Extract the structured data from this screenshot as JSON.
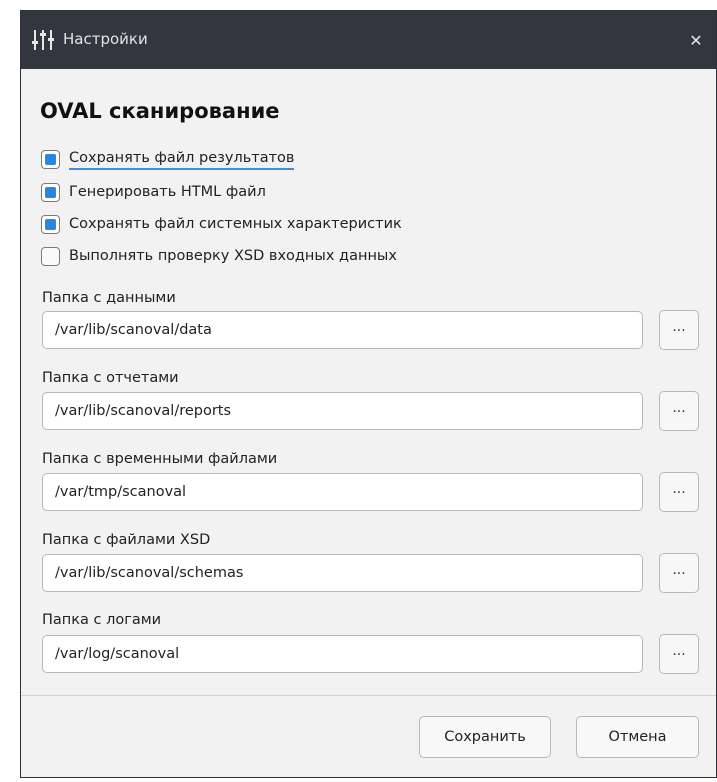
{
  "window": {
    "title": "Настройки",
    "icon": "sliders-icon",
    "close_icon": "close-icon",
    "close_glyph": "✕"
  },
  "section": {
    "title": "OVAL сканирование"
  },
  "options": [
    {
      "label": "Сохранять файл результатов",
      "checked": true
    },
    {
      "label": "Генерировать HTML файл",
      "checked": true
    },
    {
      "label": "Сохранять файл системных характеристик",
      "checked": true
    },
    {
      "label": "Выполнять проверку XSD входных данных",
      "checked": false
    }
  ],
  "paths": [
    {
      "label": "Папка с данными",
      "value": "/var/lib/scanoval/data"
    },
    {
      "label": "Папка с отчетами",
      "value": "/var/lib/scanoval/reports"
    },
    {
      "label": "Папка с временными файлами",
      "value": "/var/tmp/scanoval"
    },
    {
      "label": "Папка с файлами XSD",
      "value": "/var/lib/scanoval/schemas"
    },
    {
      "label": "Папка с логами",
      "value": "/var/log/scanoval"
    }
  ],
  "browse_label": "...",
  "footer": {
    "save_label": "Сохранить",
    "cancel_label": "Отмена"
  },
  "colors": {
    "titlebar": "#31363f",
    "accent": "#2787e0",
    "background": "#f2f2f2"
  }
}
